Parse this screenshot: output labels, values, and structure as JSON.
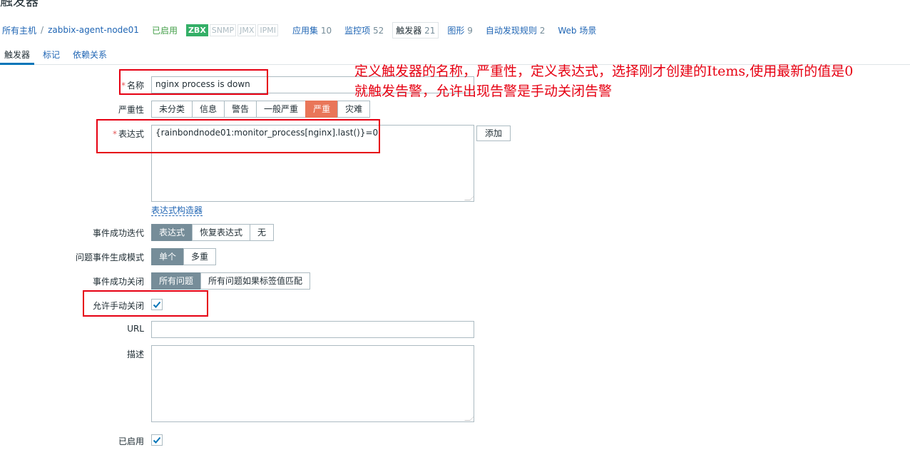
{
  "page": {
    "title": "触发器"
  },
  "breadcrumb": {
    "all_hosts": "所有主机",
    "separator": "/",
    "host": "zabbix-agent-node01",
    "status": "已启用",
    "availability": [
      "ZBX",
      "SNMP",
      "JMX",
      "IPMI"
    ],
    "links": [
      {
        "label": "应用集",
        "count": "10"
      },
      {
        "label": "监控项",
        "count": "52"
      },
      {
        "label": "触发器",
        "count": "21"
      },
      {
        "label": "图形",
        "count": "9"
      },
      {
        "label": "自动发现规则",
        "count": "2"
      },
      {
        "label": "Web 场景",
        "count": ""
      }
    ]
  },
  "tabs": [
    "触发器",
    "标记",
    "依赖关系"
  ],
  "form": {
    "name": {
      "label": "名称",
      "value": "nginx process is down"
    },
    "severity": {
      "label": "严重性",
      "options": [
        "未分类",
        "信息",
        "警告",
        "一般严重",
        "严重",
        "灾难"
      ],
      "selected": "严重"
    },
    "expression": {
      "label": "表达式",
      "value": "{rainbondnode01:monitor_process[nginx].last()}=0",
      "add_button": "添加",
      "constructor_link": "表达式构造器"
    },
    "ok_event": {
      "label": "事件成功迭代",
      "options": [
        "表达式",
        "恢复表达式",
        "无"
      ],
      "selected": "表达式"
    },
    "event_mode": {
      "label": "问题事件生成模式",
      "options": [
        "单个",
        "多重"
      ],
      "selected": "单个"
    },
    "ok_close": {
      "label": "事件成功关闭",
      "options": [
        "所有问题",
        "所有问题如果标签值匹配"
      ],
      "selected": "所有问题"
    },
    "manual_close": {
      "label": "允许手动关闭",
      "checked": true
    },
    "url": {
      "label": "URL",
      "value": ""
    },
    "description": {
      "label": "描述",
      "value": ""
    },
    "enabled": {
      "label": "已启用",
      "checked": true
    }
  },
  "annotation": {
    "line1": "定义触发器的名称，严重性，定义表达式，选择刚才创建的Items,使用最新的值是0",
    "line2": "就触发告警，允许出现告警是手动关闭告警",
    "color": "#e60012"
  },
  "colors": {
    "link": "#1f65b4",
    "selected": "#768d99",
    "severity_selected": "#e97659",
    "zbx_available": "#34af67"
  }
}
